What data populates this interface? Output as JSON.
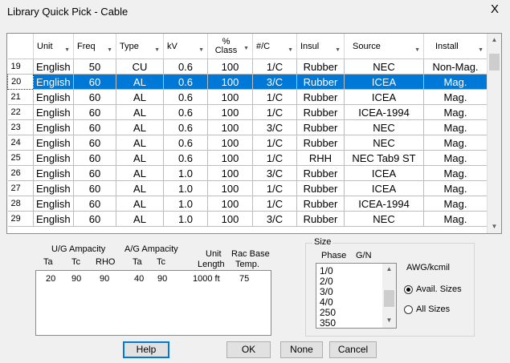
{
  "window": {
    "title": "Library Quick Pick - Cable",
    "close_glyph": "X"
  },
  "table": {
    "columns": [
      {
        "label": "Unit"
      },
      {
        "label": "Freq"
      },
      {
        "label": "Type"
      },
      {
        "label": "kV"
      },
      {
        "label": "% Class"
      },
      {
        "label": "#/C"
      },
      {
        "label": "Insul"
      },
      {
        "label": "Source"
      },
      {
        "label": "Install"
      }
    ],
    "rows": [
      {
        "num": "19",
        "unit": "English",
        "freq": "50",
        "type": "CU",
        "kv": "0.6",
        "cls": "100",
        "nc": "1/C",
        "insul": "Rubber",
        "source": "NEC",
        "install": "Non-Mag."
      },
      {
        "num": "20",
        "unit": "English",
        "freq": "60",
        "type": "AL",
        "kv": "0.6",
        "cls": "100",
        "nc": "3/C",
        "insul": "Rubber",
        "source": "ICEA",
        "install": "Mag."
      },
      {
        "num": "21",
        "unit": "English",
        "freq": "60",
        "type": "AL",
        "kv": "0.6",
        "cls": "100",
        "nc": "1/C",
        "insul": "Rubber",
        "source": "ICEA",
        "install": "Mag."
      },
      {
        "num": "22",
        "unit": "English",
        "freq": "60",
        "type": "AL",
        "kv": "0.6",
        "cls": "100",
        "nc": "1/C",
        "insul": "Rubber",
        "source": "ICEA-1994",
        "install": "Mag."
      },
      {
        "num": "23",
        "unit": "English",
        "freq": "60",
        "type": "AL",
        "kv": "0.6",
        "cls": "100",
        "nc": "3/C",
        "insul": "Rubber",
        "source": "NEC",
        "install": "Mag."
      },
      {
        "num": "24",
        "unit": "English",
        "freq": "60",
        "type": "AL",
        "kv": "0.6",
        "cls": "100",
        "nc": "1/C",
        "insul": "Rubber",
        "source": "NEC",
        "install": "Mag."
      },
      {
        "num": "25",
        "unit": "English",
        "freq": "60",
        "type": "AL",
        "kv": "0.6",
        "cls": "100",
        "nc": "1/C",
        "insul": "RHH",
        "source": "NEC Tab9 ST",
        "install": "Mag."
      },
      {
        "num": "26",
        "unit": "English",
        "freq": "60",
        "type": "AL",
        "kv": "1.0",
        "cls": "100",
        "nc": "3/C",
        "insul": "Rubber",
        "source": "ICEA",
        "install": "Mag."
      },
      {
        "num": "27",
        "unit": "English",
        "freq": "60",
        "type": "AL",
        "kv": "1.0",
        "cls": "100",
        "nc": "1/C",
        "insul": "Rubber",
        "source": "ICEA",
        "install": "Mag."
      },
      {
        "num": "28",
        "unit": "English",
        "freq": "60",
        "type": "AL",
        "kv": "1.0",
        "cls": "100",
        "nc": "1/C",
        "insul": "Rubber",
        "source": "ICEA-1994",
        "install": "Mag."
      },
      {
        "num": "29",
        "unit": "English",
        "freq": "60",
        "type": "AL",
        "kv": "1.0",
        "cls": "100",
        "nc": "3/C",
        "insul": "Rubber",
        "source": "NEC",
        "install": "Mag."
      }
    ],
    "selected_row": "20"
  },
  "ampacity": {
    "ug_label": "U/G Ampacity",
    "ag_label": "A/G Ampacity",
    "unit_label": "Unit",
    "length_label": "Length",
    "rac_label": "Rac Base",
    "temp_label": "Temp.",
    "ta_label": "Ta",
    "tc_label": "Tc",
    "rho_label": "RHO",
    "ag_ta_label": "Ta",
    "ag_tc_label": "Tc",
    "values": {
      "ug_ta": "20",
      "ug_tc": "90",
      "rho": "90",
      "ag_ta": "40",
      "ag_tc": "90",
      "length": "1000 ft",
      "temp": "75"
    }
  },
  "size": {
    "group_label": "Size",
    "phase_label": "Phase",
    "gn_label": "G/N",
    "items": [
      "1/0",
      "2/0",
      "3/0",
      "4/0",
      "250",
      "350"
    ],
    "awg_label": "AWG/kcmil",
    "avail_label": "Avail. Sizes",
    "all_label": "All Sizes",
    "selected_option": "Avail. Sizes"
  },
  "buttons": {
    "help": "Help",
    "ok": "OK",
    "none": "None",
    "cancel": "Cancel"
  },
  "colors": {
    "selection": "#0078d7",
    "default_border": "#0078d7"
  }
}
